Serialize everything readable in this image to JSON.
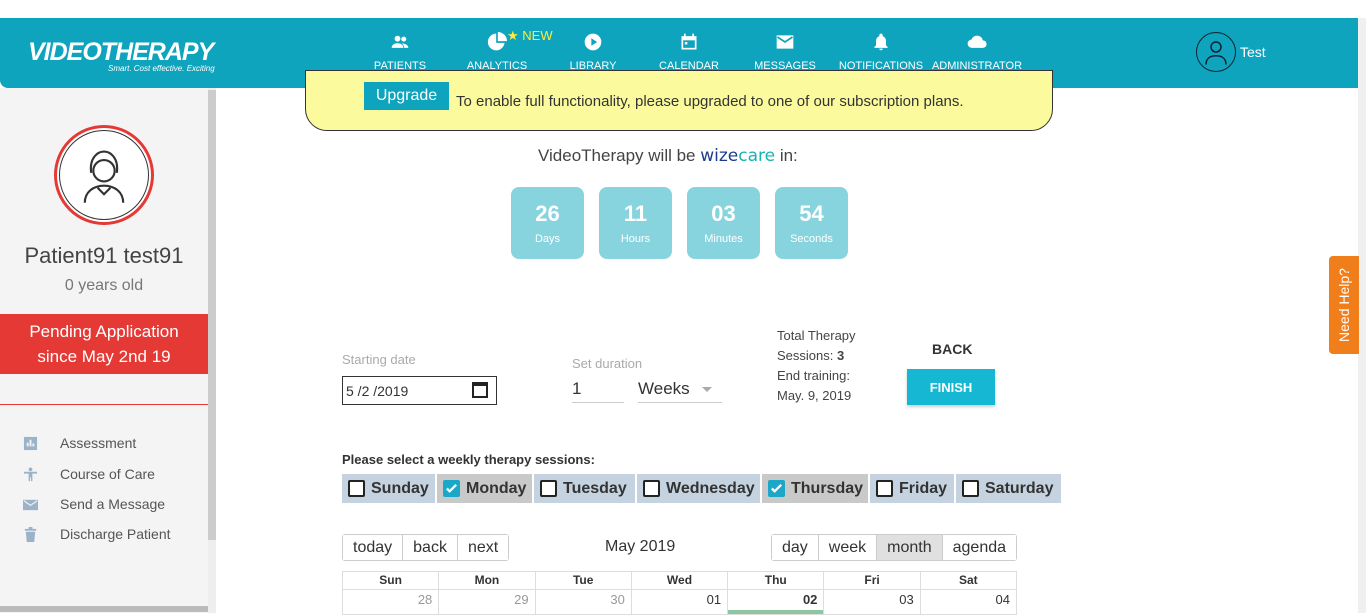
{
  "brand": {
    "name": "VIDEOTHERAPY",
    "tagline": "Smart. Cost effective. Exciting"
  },
  "nav": {
    "items": [
      {
        "label": "PATIENTS",
        "icon": "people-icon"
      },
      {
        "label": "ANALYTICS",
        "icon": "pie-chart-icon",
        "badge": "New"
      },
      {
        "label": "LIBRARY",
        "icon": "play-icon"
      },
      {
        "label": "CALENDAR",
        "icon": "calendar-icon"
      },
      {
        "label": "MESSAGES",
        "icon": "mail-icon"
      },
      {
        "label": "NOTIFICATIONS",
        "icon": "bell-icon"
      },
      {
        "label": "ADMINISTRATOR",
        "icon": "cloud-icon"
      }
    ],
    "user": "Test"
  },
  "sidebar": {
    "patient_name": "Patient91 test91",
    "age": "0 years old",
    "pending_line1": "Pending Application",
    "pending_line2": "since May 2nd 19",
    "links": [
      {
        "label": "Assessment",
        "icon": "chart-icon"
      },
      {
        "label": "Course of Care",
        "icon": "person-icon"
      },
      {
        "label": "Send a Message",
        "icon": "mail-icon"
      },
      {
        "label": "Discharge Patient",
        "icon": "trash-icon"
      }
    ]
  },
  "banner": {
    "button": "Upgrade",
    "text": "To enable full functionality, please upgraded to one of our subscription plans."
  },
  "countdown": {
    "prefix": "VideoTherapy will be",
    "brand_a": "wize",
    "brand_b": "care",
    "suffix": "in:",
    "units": [
      {
        "value": "26",
        "label": "Days"
      },
      {
        "value": "11",
        "label": "Hours"
      },
      {
        "value": "03",
        "label": "Minutes"
      },
      {
        "value": "54",
        "label": "Seconds"
      }
    ]
  },
  "form": {
    "start_label": "Starting date",
    "start_value": "5 /2 /2019",
    "duration_label": "Set duration",
    "duration_value": "1",
    "duration_unit": "Weeks",
    "summary_l1": "Total Therapy",
    "summary_l2_label": "Sessions:",
    "summary_l2_value": "3",
    "summary_l3": "End training:",
    "summary_l4": "May. 9, 2019",
    "back": "BACK",
    "finish": "FINISH"
  },
  "weekly": {
    "label": "Please select a weekly therapy sessions:",
    "days": [
      {
        "label": "Sunday",
        "checked": false
      },
      {
        "label": "Monday",
        "checked": true
      },
      {
        "label": "Tuesday",
        "checked": false
      },
      {
        "label": "Wednesday",
        "checked": false
      },
      {
        "label": "Thursday",
        "checked": true
      },
      {
        "label": "Friday",
        "checked": false
      },
      {
        "label": "Saturday",
        "checked": false
      }
    ]
  },
  "calendar": {
    "nav": [
      "today",
      "back",
      "next"
    ],
    "month": "May 2019",
    "views": [
      "day",
      "week",
      "month",
      "agenda"
    ],
    "active_view": "month",
    "headers": [
      "Sun",
      "Mon",
      "Tue",
      "Wed",
      "Thu",
      "Fri",
      "Sat"
    ],
    "row1": [
      "28",
      "29",
      "30",
      "01",
      "02",
      "03",
      "04"
    ]
  },
  "help": "Need Help?"
}
